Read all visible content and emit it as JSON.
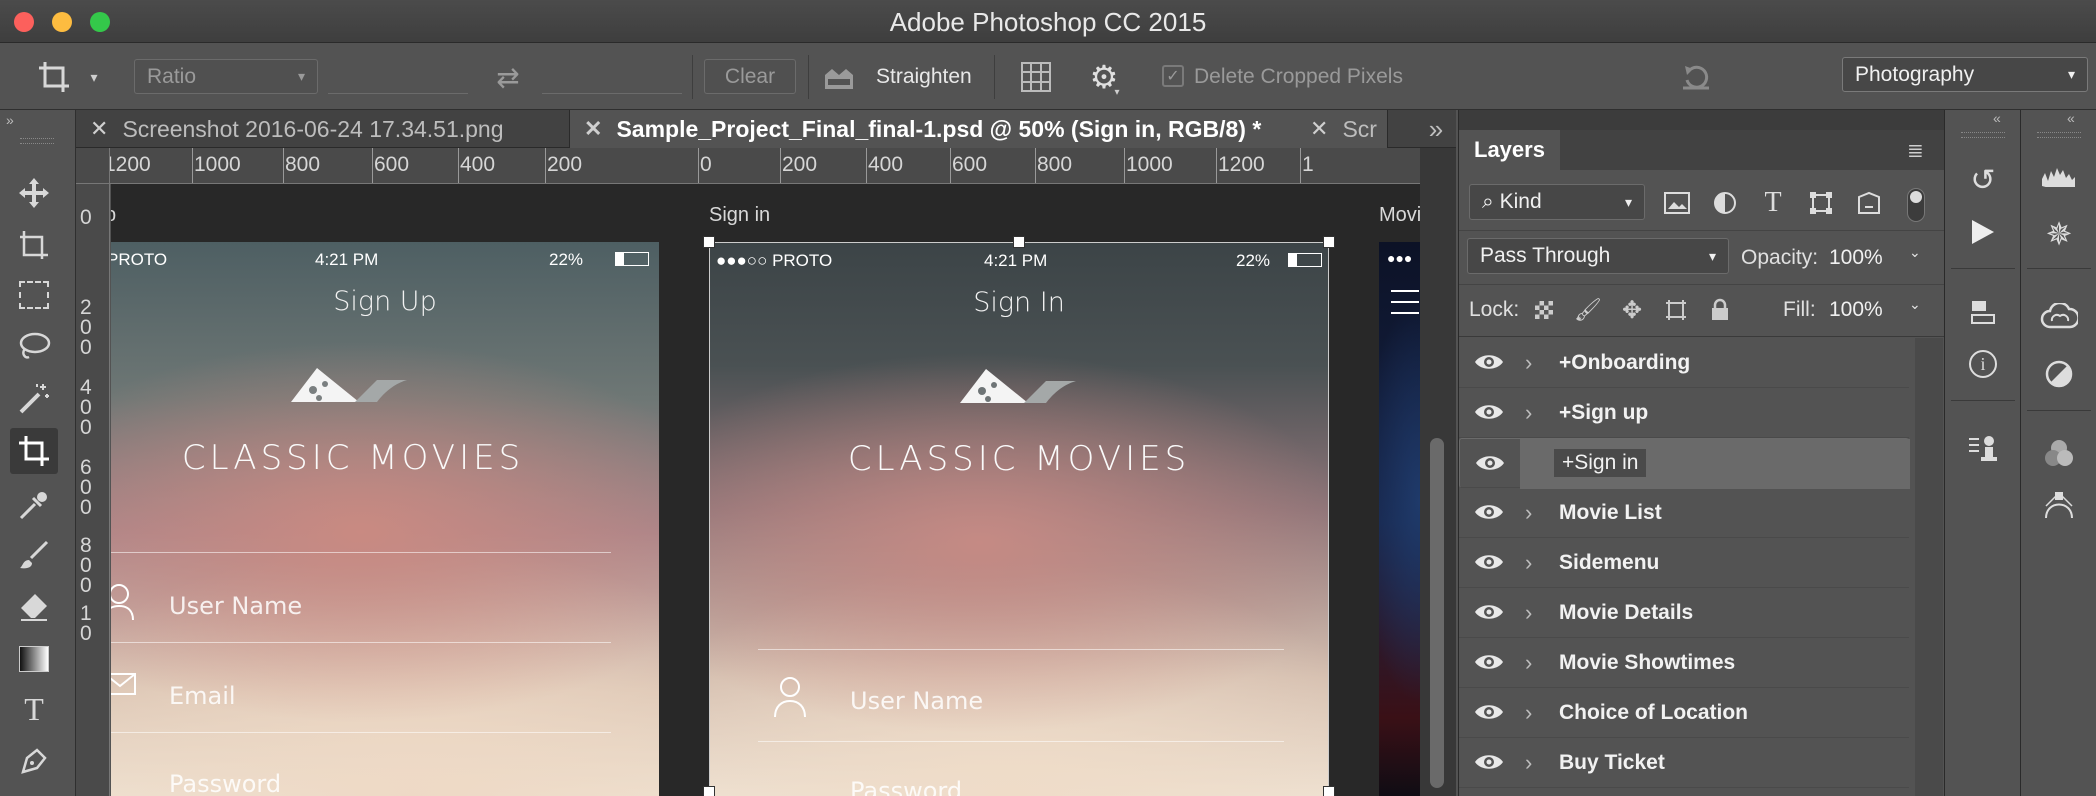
{
  "window": {
    "title": "Adobe Photoshop CC 2015"
  },
  "options_bar": {
    "ratio_label": "Ratio",
    "clear_label": "Clear",
    "straighten_label": "Straighten",
    "delete_cropped_label": "Delete Cropped Pixels",
    "delete_cropped_checked": true,
    "workspace": "Photography"
  },
  "doc_tabs": [
    {
      "label": "Screenshot 2016-06-24 17.34.51.png",
      "active": false
    },
    {
      "label": "Sample_Project_Final_final-1.psd @ 50% (Sign in, RGB/8) *",
      "active": true
    },
    {
      "label": "Scr",
      "active": false
    }
  ],
  "ruler": {
    "horizontal": [
      "1200",
      "1000",
      "800",
      "600",
      "400",
      "200",
      "0",
      "200",
      "400",
      "600",
      "800",
      "1000",
      "1200",
      "1"
    ],
    "vertical": [
      "0",
      "0",
      "2 0 0",
      "4 0 0",
      "6 0 0",
      "8 0 0",
      "1 0"
    ]
  },
  "artboards": {
    "signup": {
      "label": "Sign Up",
      "label_partial": "p",
      "carrier": "PROTO",
      "time": "4:21 PM",
      "battery": "22%",
      "heading": "Sign Up",
      "brand": "CLASSIC MOVIES",
      "fields": [
        "User Name",
        "Email",
        "Password"
      ]
    },
    "signin": {
      "label": "Sign in",
      "carrier": "●●●○○ PROTO",
      "time": "4:21 PM",
      "battery": "22%",
      "heading": "Sign In",
      "brand": "CLASSIC MOVIES",
      "fields": [
        "User Name",
        "Password"
      ]
    },
    "movies": {
      "label": "Movi"
    }
  },
  "layers_panel": {
    "title": "Layers",
    "filter_kind": "Kind",
    "blend_mode": "Pass Through",
    "opacity_label": "Opacity:",
    "opacity_value": "100%",
    "lock_label": "Lock:",
    "fill_label": "Fill:",
    "fill_value": "100%",
    "layers": [
      {
        "name": "+Onboarding",
        "selected": false
      },
      {
        "name": "+Sign up",
        "selected": false
      },
      {
        "name": "+Sign in",
        "selected": true
      },
      {
        "name": "Movie List",
        "selected": false
      },
      {
        "name": "Sidemenu",
        "selected": false
      },
      {
        "name": "Movie Details",
        "selected": false
      },
      {
        "name": "Movie Showtimes",
        "selected": false
      },
      {
        "name": "Choice of Location",
        "selected": false
      },
      {
        "name": "Buy Ticket",
        "selected": false
      }
    ]
  },
  "icons": {
    "tools": [
      "move-icon",
      "artboard-icon",
      "marquee-icon",
      "lasso-icon",
      "magic-wand-icon",
      "crop-icon",
      "eyedropper-icon",
      "brush-icon",
      "eraser-icon",
      "gradient-icon",
      "type-icon",
      "pen-icon"
    ],
    "dock_a": [
      "history-icon",
      "play-icon",
      "3d-icon",
      "info-icon",
      "clone-source-icon"
    ],
    "dock_b": [
      "histogram-icon",
      "navigator-icon",
      "libraries-icon",
      "adjustments-icon",
      "channels-icon",
      "paths-icon"
    ]
  },
  "colors": {
    "traffic_red": "#fc605c",
    "traffic_yellow": "#fdbc40",
    "traffic_green": "#34c84a"
  }
}
